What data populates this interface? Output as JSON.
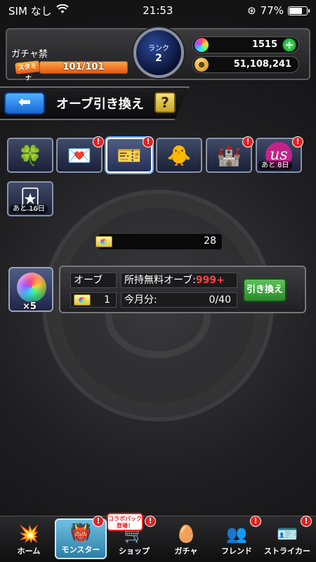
{
  "status_bar": {
    "carrier": "SIM なし",
    "time": "21:53",
    "battery": "77%",
    "battery_level": 0.77
  },
  "player": {
    "gacha_label": "ガチャ禁",
    "stamina_label": "スタミナ",
    "stamina": "101/101",
    "stamina_fill": 1.0,
    "rank_label": "ランク",
    "rank": "2",
    "orbs": "1515",
    "gold": "51,108,241"
  },
  "title_bar": {
    "title": "オーブ引き換え",
    "help": "?"
  },
  "items": [
    {
      "icon": "clover-hat-icon",
      "glyph": "🍀",
      "badge": false,
      "timer": ""
    },
    {
      "icon": "gift-card-icon",
      "glyph": "💌",
      "badge": true,
      "timer": ""
    },
    {
      "icon": "orb-ticket-icon",
      "glyph": "🎫",
      "badge": true,
      "timer": "",
      "selected": true
    },
    {
      "icon": "dragon-chick-icon",
      "glyph": "🐥",
      "badge": false,
      "timer": ""
    },
    {
      "icon": "castle-icon",
      "glyph": "🏰",
      "badge": true,
      "timer": ""
    },
    {
      "icon": "us-logo-icon",
      "glyph": "𝓊𝓈",
      "badge": true,
      "timer": "あと 8日"
    },
    {
      "icon": "orb-exchange-card-icon",
      "glyph": "🃏",
      "badge": false,
      "timer": "あと 16日"
    }
  ],
  "ticket": {
    "count": "28"
  },
  "exchange": {
    "orb_multiplier": "×5",
    "orb_label": "オーブ",
    "ticket_qty": "1",
    "free_orbs_label": "所持無料オーブ:",
    "free_orbs_value": "999+",
    "monthly_label": "今月分:",
    "monthly_value": "0/40",
    "button": "引き換え"
  },
  "nav": {
    "collab_tag": "コラボパック登場！",
    "items": [
      {
        "label": "ホーム",
        "icon": "home-icon",
        "glyph": "💥"
      },
      {
        "label": "モンスター",
        "icon": "monster-icon",
        "glyph": "👹"
      },
      {
        "label": "ショップ",
        "icon": "shop-cart-icon",
        "glyph": "🛒"
      },
      {
        "label": "ガチャ",
        "icon": "gacha-egg-icon",
        "glyph": "🥚"
      },
      {
        "label": "フレンド",
        "icon": "friend-icon",
        "glyph": "👥"
      },
      {
        "label": "ストライカー",
        "icon": "striker-icon",
        "glyph": "🪪"
      }
    ]
  },
  "colors": {
    "accent_blue": "#1867d6",
    "badge_red": "#e32222",
    "exchange_green": "#2a8a2a",
    "free_orb_red": "#ff4444"
  }
}
